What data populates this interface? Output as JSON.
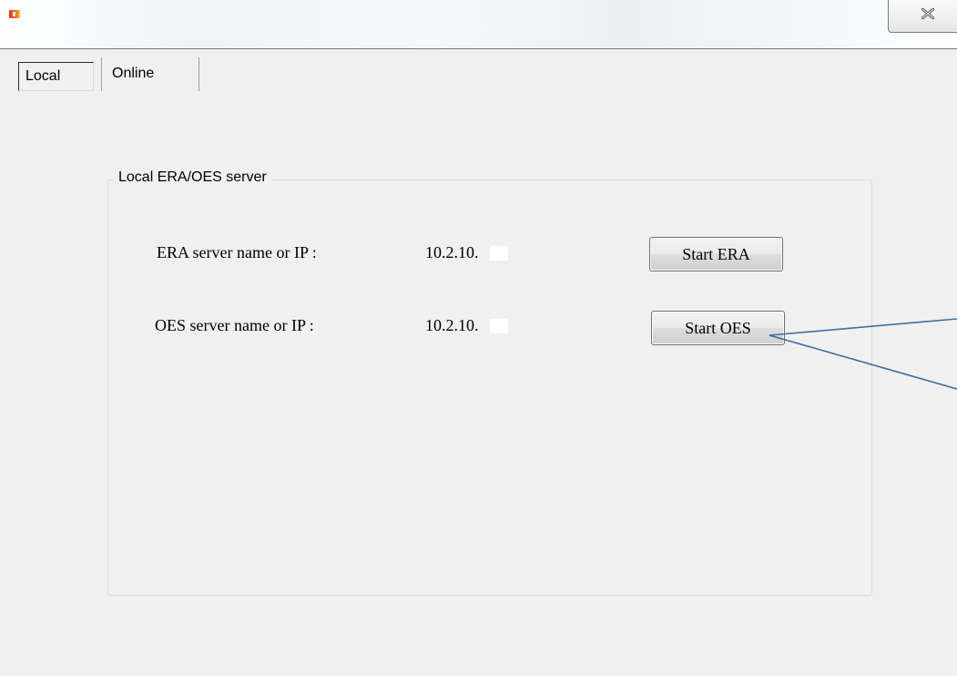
{
  "window": {
    "icon": "app-icon",
    "close_icon": "close-icon"
  },
  "tabs": [
    {
      "label": "Local",
      "selected": true
    },
    {
      "label": "Online",
      "selected": false
    }
  ],
  "group": {
    "title": "Local ERA/OES server",
    "rows": [
      {
        "label": "ERA server name or IP :",
        "value": "10.2.10.",
        "button": "Start ERA"
      },
      {
        "label": "OES server name or IP :",
        "value": "10.2.10.",
        "button": "Start OES"
      }
    ]
  },
  "annotation": {
    "color": "#3f6fa0"
  }
}
